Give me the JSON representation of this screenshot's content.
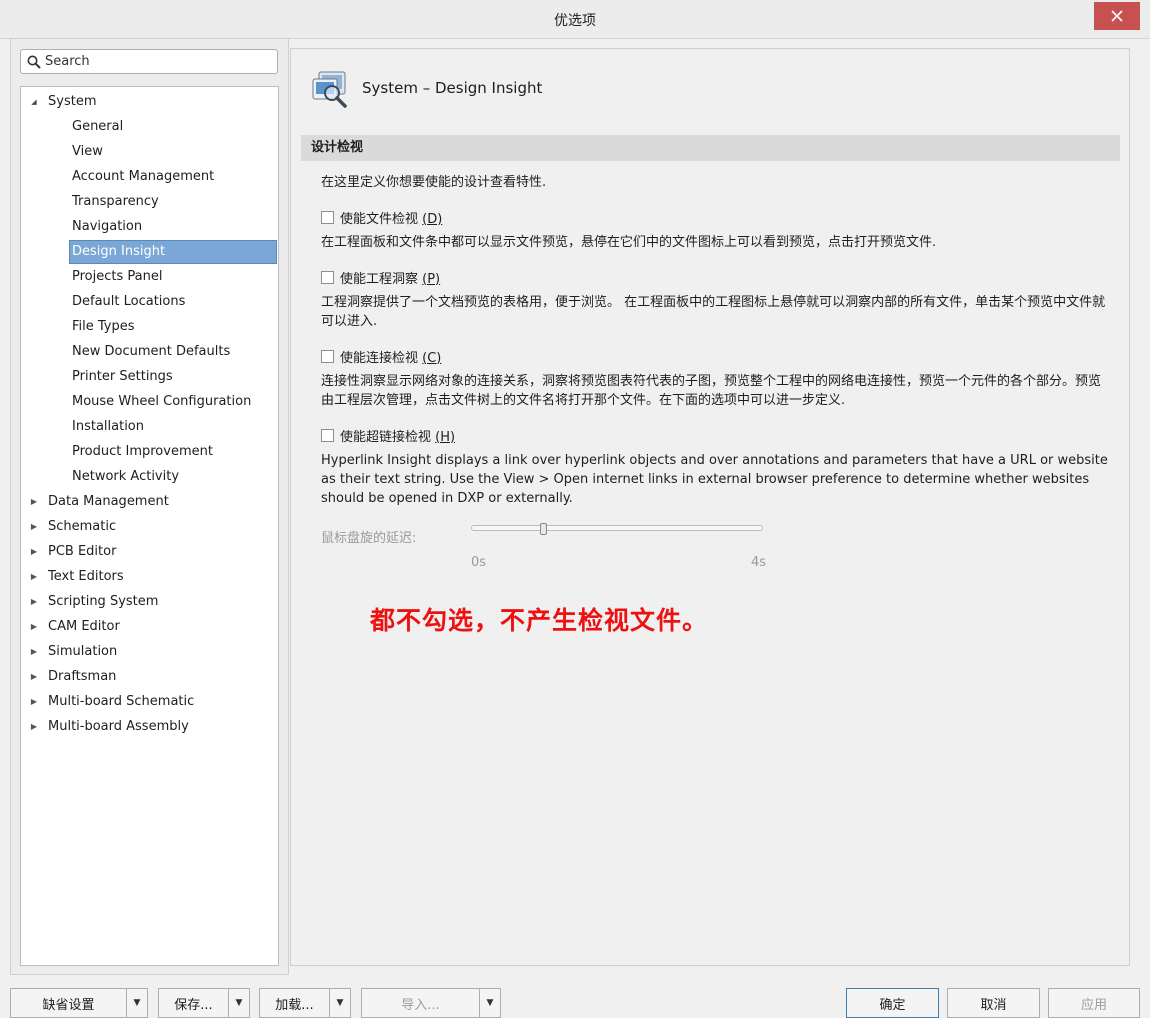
{
  "window": {
    "title": "优选项"
  },
  "search": {
    "placeholder": "Search"
  },
  "tree": {
    "items": [
      {
        "label": "System",
        "level": 0,
        "expanded": true,
        "selected": false
      },
      {
        "label": "General",
        "level": 1,
        "selected": false
      },
      {
        "label": "View",
        "level": 1,
        "selected": false
      },
      {
        "label": "Account Management",
        "level": 1,
        "selected": false
      },
      {
        "label": "Transparency",
        "level": 1,
        "selected": false
      },
      {
        "label": "Navigation",
        "level": 1,
        "selected": false
      },
      {
        "label": "Design Insight",
        "level": 1,
        "selected": true
      },
      {
        "label": "Projects Panel",
        "level": 1,
        "selected": false
      },
      {
        "label": "Default Locations",
        "level": 1,
        "selected": false
      },
      {
        "label": "File Types",
        "level": 1,
        "selected": false
      },
      {
        "label": "New Document Defaults",
        "level": 1,
        "selected": false
      },
      {
        "label": "Printer Settings",
        "level": 1,
        "selected": false
      },
      {
        "label": "Mouse Wheel Configuration",
        "level": 1,
        "selected": false
      },
      {
        "label": "Installation",
        "level": 1,
        "selected": false
      },
      {
        "label": "Product Improvement",
        "level": 1,
        "selected": false
      },
      {
        "label": "Network Activity",
        "level": 1,
        "selected": false
      },
      {
        "label": "Data Management",
        "level": 0,
        "expanded": false,
        "selected": false
      },
      {
        "label": "Schematic",
        "level": 0,
        "expanded": false,
        "selected": false
      },
      {
        "label": "PCB Editor",
        "level": 0,
        "expanded": false,
        "selected": false
      },
      {
        "label": "Text Editors",
        "level": 0,
        "expanded": false,
        "selected": false
      },
      {
        "label": "Scripting System",
        "level": 0,
        "expanded": false,
        "selected": false
      },
      {
        "label": "CAM Editor",
        "level": 0,
        "expanded": false,
        "selected": false
      },
      {
        "label": "Simulation",
        "level": 0,
        "expanded": false,
        "selected": false
      },
      {
        "label": "Draftsman",
        "level": 0,
        "expanded": false,
        "selected": false
      },
      {
        "label": "Multi-board Schematic",
        "level": 0,
        "expanded": false,
        "selected": false
      },
      {
        "label": "Multi-board Assembly",
        "level": 0,
        "expanded": false,
        "selected": false
      }
    ]
  },
  "page": {
    "header_title": "System – Design Insight",
    "section_title": "设计检视",
    "intro": "在这里定义你想要使能的设计查看特性.",
    "options": [
      {
        "label": "使能文件检视 ",
        "accel": "(D)",
        "checked": false,
        "description": "在工程面板和文件条中都可以显示文件预览，悬停在它们中的文件图标上可以看到预览，点击打开预览文件."
      },
      {
        "label": "使能工程洞察 ",
        "accel": "(P)",
        "checked": false,
        "description": "工程洞察提供了一个文档预览的表格用，便于浏览。 在工程面板中的工程图标上悬停就可以洞察内部的所有文件，单击某个预览中文件就可以进入."
      },
      {
        "label": "使能连接检视 ",
        "accel": "(C)",
        "checked": false,
        "description": "连接性洞察显示网络对象的连接关系，洞察将预览图表符代表的子图，预览整个工程中的网络电连接性，预览一个元件的各个部分。预览由工程层次管理，点击文件树上的文件名将打开那个文件。在下面的选项中可以进一步定义."
      },
      {
        "label": "使能超链接检视 ",
        "accel": "(H)",
        "checked": false,
        "description": "Hyperlink Insight displays a link over hyperlink objects and over annotations and parameters that have a URL or website as their text string. Use the View > Open internet links in external browser preference to determine whether websites should be opened in DXP or externally."
      }
    ],
    "slider": {
      "label": "鼠标盘旋的延迟:",
      "min_label": "0s",
      "max_label": "4s",
      "value_fraction": 0.25
    },
    "annotation": "都不勾选，不产生检视文件。"
  },
  "buttons": {
    "defaults": "缺省设置",
    "save": "保存...",
    "load": "加载...",
    "import": "导入...",
    "ok": "确定",
    "cancel": "取消",
    "apply": "应用"
  }
}
